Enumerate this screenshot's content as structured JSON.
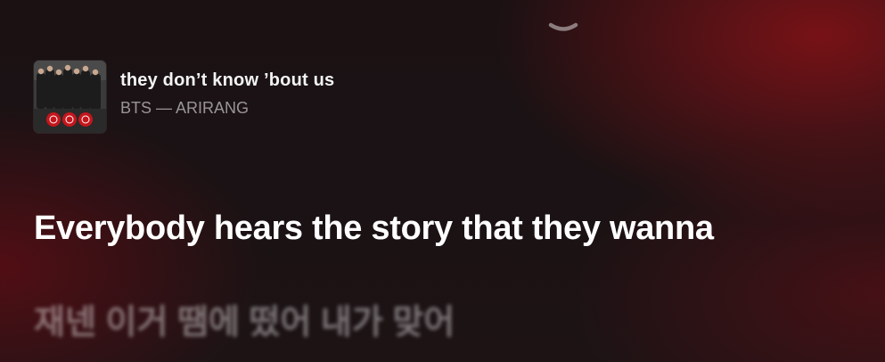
{
  "player": {
    "collapse_icon": "chevron-down-icon",
    "artwork_icon": "album-artwork",
    "track": {
      "title": "they don’t know ’bout us",
      "subtitle": "BTS — ARIRANG"
    }
  },
  "lyrics": {
    "current": "Everybody hears the story that they wanna",
    "next": "재넨 이거 땜에 떴어 내가 맞어"
  },
  "colors": {
    "background": "#1a1214",
    "accent_red": "#961218",
    "text_primary": "#ffffff",
    "text_secondary": "rgba(255,255,255,0.55)"
  }
}
